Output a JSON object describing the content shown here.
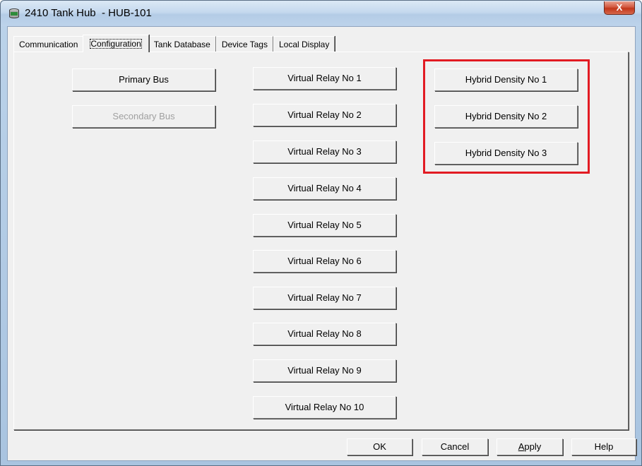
{
  "window": {
    "title": "2410 Tank Hub  - HUB-101",
    "close_label": "X"
  },
  "tabs": [
    {
      "label": "Communication"
    },
    {
      "label": "Configuration"
    },
    {
      "label": "Tank Database"
    },
    {
      "label": "Device Tags"
    },
    {
      "label": "Local Display"
    }
  ],
  "config": {
    "bus_buttons": [
      {
        "label": "Primary Bus",
        "enabled": true
      },
      {
        "label": "Secondary Bus",
        "enabled": false
      }
    ],
    "relay_buttons": [
      {
        "label": "Virtual Relay No 1"
      },
      {
        "label": "Virtual Relay No 2"
      },
      {
        "label": "Virtual Relay No 3"
      },
      {
        "label": "Virtual Relay No 4"
      },
      {
        "label": "Virtual Relay No 5"
      },
      {
        "label": "Virtual Relay No 6"
      },
      {
        "label": "Virtual Relay No 7"
      },
      {
        "label": "Virtual Relay No 8"
      },
      {
        "label": "Virtual Relay No 9"
      },
      {
        "label": "Virtual Relay No 10"
      }
    ],
    "density_buttons": [
      {
        "label": "Hybrid Density No 1"
      },
      {
        "label": "Hybrid Density No 2"
      },
      {
        "label": "Hybrid Density No 3"
      }
    ],
    "highlight_color": "#e21b23"
  },
  "footer": {
    "ok_label": "OK",
    "cancel_label": "Cancel",
    "apply_first": "A",
    "apply_rest": "pply",
    "help_label": "Help"
  },
  "icons": {
    "window_icon": "tank-icon"
  }
}
